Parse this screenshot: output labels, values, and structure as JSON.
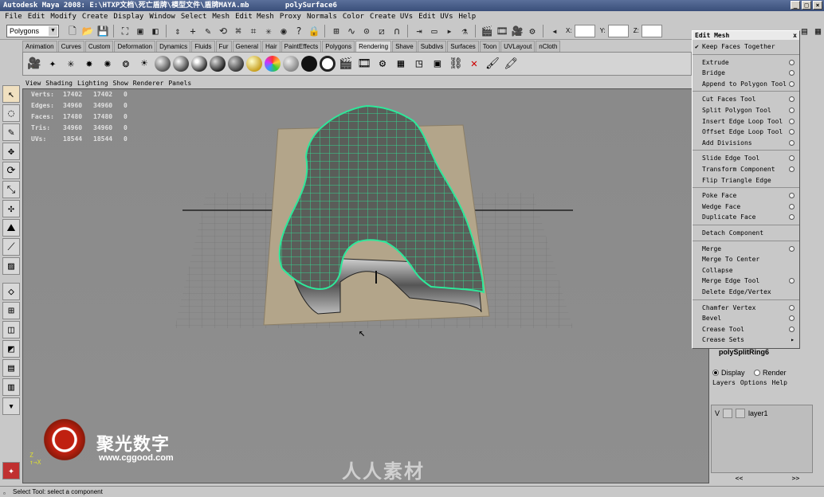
{
  "window": {
    "title": "Autodesk Maya 2008: E:\\HTXP文档\\死亡盾牌\\模型文件\\盾牌MAYA.mb",
    "object": "polySurface6"
  },
  "menus": [
    "File",
    "Edit",
    "Modify",
    "Create",
    "Display",
    "Window",
    "Select",
    "Mesh",
    "Edit Mesh",
    "Proxy",
    "Normals",
    "Color",
    "Create UVs",
    "Edit UVs",
    "Help"
  ],
  "statusline": {
    "mode": "Polygons",
    "x_label": "X:",
    "y_label": "Y:",
    "z_label": "Z:"
  },
  "shelf_tabs": [
    "Animation",
    "Curves",
    "Custom",
    "Deformation",
    "Dynamics",
    "Fluids",
    "Fur",
    "General",
    "Hair",
    "PaintEffects",
    "Polygons",
    "Rendering",
    "Shave",
    "Subdivs",
    "Surfaces",
    "Toon",
    "UVLayout",
    "nCloth"
  ],
  "active_shelf": "Rendering",
  "panel_menu": [
    "View",
    "Shading",
    "Lighting",
    "Show",
    "Renderer",
    "Panels"
  ],
  "hud": [
    {
      "label": "Verts:",
      "a": "17402",
      "b": "17402",
      "c": "0"
    },
    {
      "label": "Edges:",
      "a": "34960",
      "b": "34960",
      "c": "0"
    },
    {
      "label": "Faces:",
      "a": "17480",
      "b": "17480",
      "c": "0"
    },
    {
      "label": "Tris:",
      "a": "34960",
      "b": "34960",
      "c": "0"
    },
    {
      "label": "UVs:",
      "a": "18544",
      "b": "18544",
      "c": "0"
    }
  ],
  "edit_mesh_menu": {
    "title": "Edit Mesh",
    "close": "x",
    "items": [
      {
        "label": "Keep Faces Together",
        "check": "✔",
        "opt": false,
        "sub": ""
      },
      {
        "label": "Extrude",
        "opt": true
      },
      {
        "label": "Bridge",
        "opt": true
      },
      {
        "label": "Append to Polygon Tool",
        "opt": true
      },
      {
        "label": "Cut Faces Tool",
        "opt": true
      },
      {
        "label": "Split Polygon Tool",
        "opt": true
      },
      {
        "label": "Insert Edge Loop Tool",
        "opt": true
      },
      {
        "label": "Offset Edge Loop Tool",
        "opt": true
      },
      {
        "label": "Add Divisions",
        "opt": true
      },
      {
        "label": "Slide Edge Tool",
        "opt": true
      },
      {
        "label": "Transform Component",
        "opt": true
      },
      {
        "label": "Flip Triangle Edge",
        "opt": false
      },
      {
        "label": "Poke Face",
        "opt": true
      },
      {
        "label": "Wedge Face",
        "opt": true
      },
      {
        "label": "Duplicate Face",
        "opt": true
      },
      {
        "label": "Detach Component",
        "opt": false
      },
      {
        "label": "Merge",
        "opt": true
      },
      {
        "label": "Merge To Center",
        "opt": false
      },
      {
        "label": "Collapse",
        "opt": false
      },
      {
        "label": "Merge Edge Tool",
        "opt": true
      },
      {
        "label": "Delete Edge/Vertex",
        "opt": false
      },
      {
        "label": "Chamfer Vertex",
        "opt": true
      },
      {
        "label": "Bevel",
        "opt": true
      },
      {
        "label": "Crease Tool",
        "opt": true
      },
      {
        "label": "Crease Sets",
        "sub": "▸"
      }
    ]
  },
  "channel_box": {
    "node": "polySplitRing6"
  },
  "layers": {
    "display": "Display",
    "render": "Render",
    "menu": [
      "Layers",
      "Options",
      "Help"
    ],
    "row": {
      "visible": "V",
      "name": "layer1"
    },
    "nav_left": "<<",
    "nav_right": ">>"
  },
  "watermark": {
    "brand": "聚光数字",
    "url": "www.cggood.com",
    "right": "人人素材"
  },
  "helpline": "Select Tool: select a component",
  "colors": {
    "wire": "#2ee89a",
    "viewport_bg": "#8c8c8c",
    "title_bg": "#3a4f7a"
  }
}
